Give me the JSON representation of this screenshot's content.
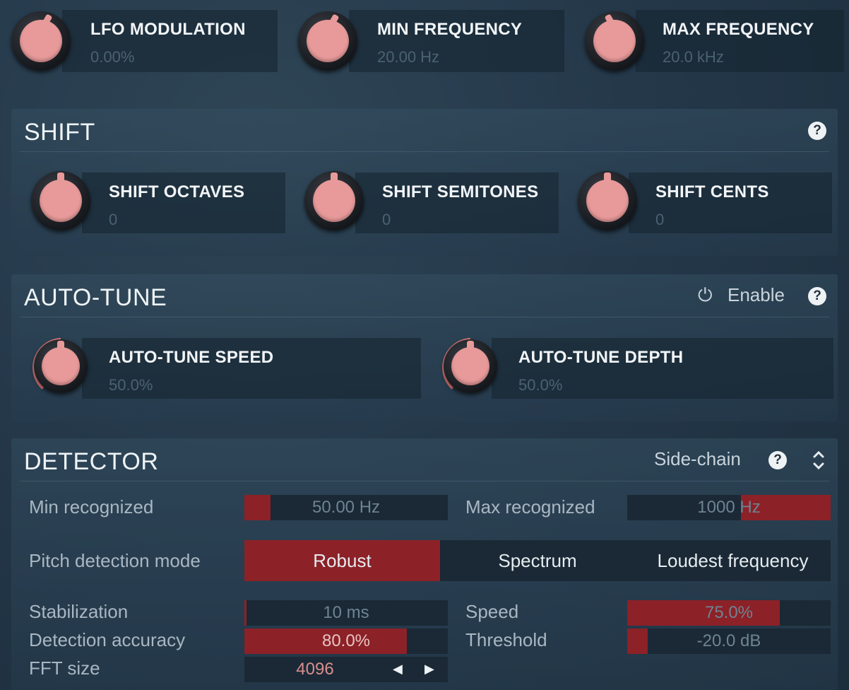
{
  "top_knobs": [
    {
      "name": "LFO MODULATION",
      "value": "0.00%"
    },
    {
      "name": "MIN FREQUENCY",
      "value": "20.00 Hz"
    },
    {
      "name": "MAX FREQUENCY",
      "value": "20.0 kHz"
    }
  ],
  "shift": {
    "title": "SHIFT",
    "help": "?",
    "knobs": [
      {
        "name": "SHIFT OCTAVES",
        "value": "0"
      },
      {
        "name": "SHIFT SEMITONES",
        "value": "0"
      },
      {
        "name": "SHIFT CENTS",
        "value": "0"
      }
    ]
  },
  "autotune": {
    "title": "AUTO-TUNE",
    "enable_label": "Enable",
    "power_icon": "⏻",
    "help": "?",
    "knobs": [
      {
        "name": "AUTO-TUNE SPEED",
        "value": "50.0%",
        "fraction": 0.5
      },
      {
        "name": "AUTO-TUNE DEPTH",
        "value": "50.0%",
        "fraction": 0.5
      }
    ]
  },
  "detector": {
    "title": "DETECTOR",
    "sidechain_label": "Side-chain",
    "help": "?",
    "expand_icon": "⌃⌄",
    "min_recognized": {
      "label": "Min recognized",
      "value": "50.00 Hz",
      "fraction": 0.13
    },
    "max_recognized": {
      "label": "Max recognized",
      "value": "1000 Hz",
      "fraction": 0.56
    },
    "pitch_mode": {
      "label": "Pitch detection mode",
      "options": [
        "Robust",
        "Spectrum",
        "Loudest frequency"
      ],
      "selected": "Robust"
    },
    "stabilization": {
      "label": "Stabilization",
      "value": "10 ms",
      "fraction": 0.01
    },
    "speed": {
      "label": "Speed",
      "value": "75.0%",
      "fraction": 0.75
    },
    "detection_accuracy": {
      "label": "Detection accuracy",
      "value": "80.0%",
      "fraction": 0.8
    },
    "threshold": {
      "label": "Threshold",
      "value": "-20.0 dB",
      "fraction": 0.1
    },
    "fft_size": {
      "label": "FFT size",
      "value": "4096",
      "prev_icon": "◀",
      "next_icon": "▶"
    }
  },
  "colors": {
    "accent": "#8c2127",
    "knob_cap": "#e89a9a",
    "background": "#24384a"
  }
}
